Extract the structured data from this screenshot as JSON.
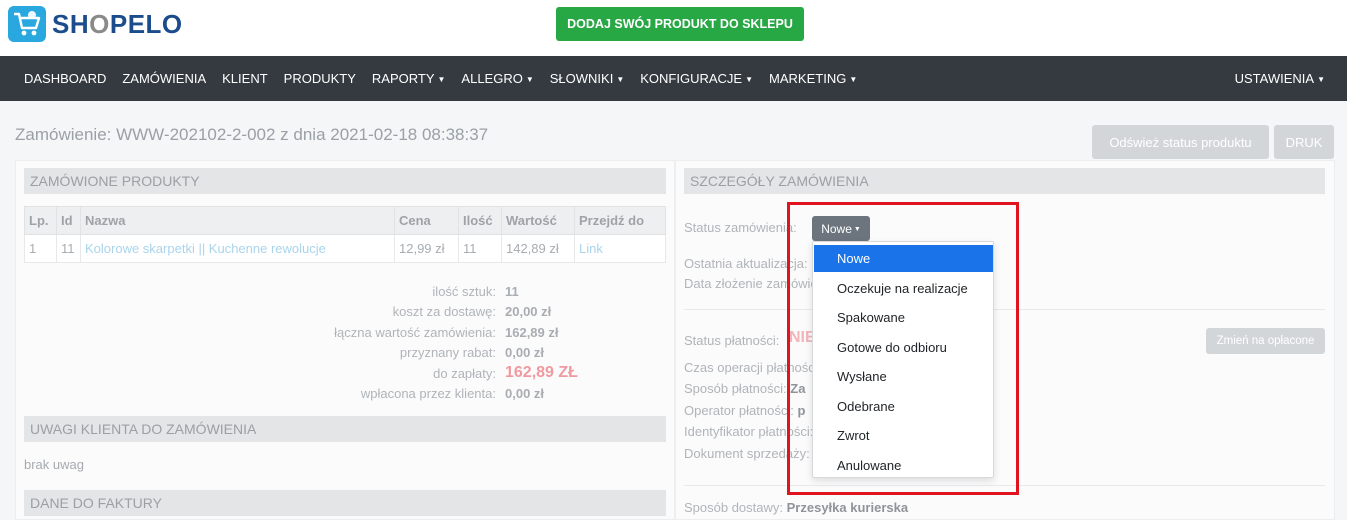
{
  "brand": {
    "logo_prefix": "SH",
    "logo_o": "O",
    "logo_suffix": "PELO"
  },
  "header": {
    "add_product_label": "DODAJ SWÓJ PRODUKT DO SKLEPU"
  },
  "nav": {
    "items": [
      {
        "label": "DASHBOARD",
        "dropdown": false
      },
      {
        "label": "ZAMÓWIENIA",
        "dropdown": false
      },
      {
        "label": "KLIENT",
        "dropdown": false
      },
      {
        "label": "PRODUKTY",
        "dropdown": false
      },
      {
        "label": "RAPORTY",
        "dropdown": true
      },
      {
        "label": "ALLEGRO",
        "dropdown": true
      },
      {
        "label": "SŁOWNIKI",
        "dropdown": true
      },
      {
        "label": "KONFIGURACJE",
        "dropdown": true
      },
      {
        "label": "MARKETING",
        "dropdown": true
      }
    ],
    "settings_label": "USTAWIENIA"
  },
  "page": {
    "title": "Zamówienie: WWW-202102-2-002 z dnia 2021-02-18 08:38:37",
    "refresh_label": "Odśwież status produktu",
    "print_label": "DRUK"
  },
  "ordered": {
    "header": "ZAMÓWIONE PRODUKTY",
    "columns": [
      "Lp.",
      "Id",
      "Nazwa",
      "Cena",
      "Ilość",
      "Wartość",
      "Przejdź do"
    ],
    "rows": [
      {
        "lp": "1",
        "id": "11",
        "name": "Kolorowe skarpetki || Kuchenne rewolucje",
        "price": "12,99 zł",
        "qty": "11",
        "value": "142,89 zł",
        "link": "Link"
      }
    ]
  },
  "summary": {
    "qty_label": "ilość sztuk:",
    "qty_value": "11",
    "shipping_label": "koszt za dostawę:",
    "shipping_value": "20,00 zł",
    "total_label": "łączna wartość zamówienia:",
    "total_value": "162,89 zł",
    "discount_label": "przyznany rabat:",
    "discount_value": "0,00 zł",
    "to_pay_label": "do zapłaty:",
    "to_pay_value": "162,89 ZŁ",
    "paid_label": "wpłacona przez klienta:",
    "paid_value": "0,00 zł"
  },
  "remarks": {
    "header": "UWAGI KLIENTA DO ZAMÓWIENIA",
    "text": "brak uwag"
  },
  "invoice": {
    "header": "DANE DO FAKTURY"
  },
  "details": {
    "header": "SZCZEGÓŁY ZAMÓWIENIA",
    "status_label": "Status zamówienia:",
    "status_value": "Nowe",
    "last_update_label": "Ostatnia aktualizacja:",
    "created_label": "Data złożenie zamówienia:",
    "pay_status_label": "Status płatności:",
    "pay_status_value": "NIE",
    "mark_paid_label": "Zmień na opłacone",
    "pay_time_label": "Czas operacji płatności:",
    "pay_method_label": "Sposób płatności:",
    "pay_method_value": "Za",
    "operator_label": "Operator płatności:",
    "operator_value": "p",
    "identifier_label": "Identyfikator płatności:",
    "document_label": "Dokument sprzedaży:",
    "delivery_label": "Sposób dostawy:",
    "delivery_value": "Przesyłka kurierska"
  },
  "status_options": [
    {
      "label": "Nowe",
      "active": true
    },
    {
      "label": "Oczekuje na realizacje",
      "active": false
    },
    {
      "label": "Spakowane",
      "active": false
    },
    {
      "label": "Gotowe do odbioru",
      "active": false
    },
    {
      "label": "Wysłane",
      "active": false
    },
    {
      "label": "Odebrane",
      "active": false
    },
    {
      "label": "Zwrot",
      "active": false
    },
    {
      "label": "Anulowane",
      "active": false
    }
  ],
  "colors": {
    "brand_blue": "#1b4d8c",
    "primary": "#1a73e8",
    "success": "#28a745",
    "navbar": "#343a40",
    "highlight": "#e0141e"
  }
}
